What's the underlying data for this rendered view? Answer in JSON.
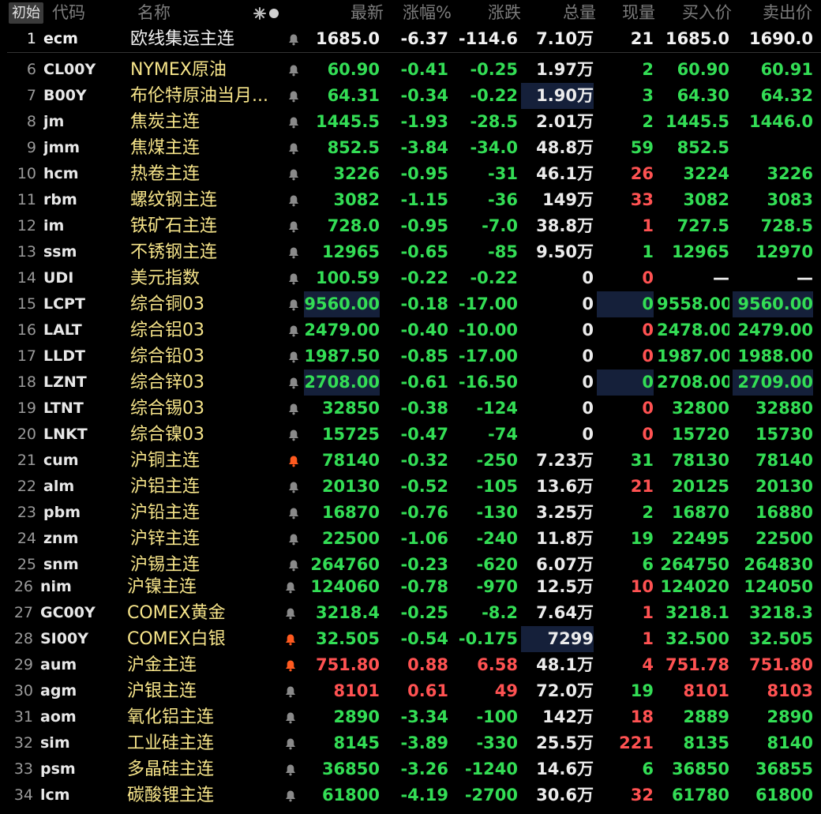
{
  "header": {
    "init_button": "初始",
    "columns": {
      "code": "代码",
      "name": "名称",
      "last": "最新",
      "pct": "涨幅%",
      "chg": "涨跌",
      "volume": "总量",
      "cur_vol": "现量",
      "bid": "买入价",
      "ask": "卖出价"
    },
    "sort_icon": "sort-mode-icon"
  },
  "colors": {
    "up": "#ff5252",
    "down": "#33dd55",
    "name": "#f7e58a",
    "highlight": "#15203a",
    "bell_active": "#ff5a1f"
  },
  "rows": [
    {
      "idx": "1",
      "code": "ecm",
      "name": "欧线集运主连",
      "bell": "normal",
      "last": "1685.0",
      "pct": "-6.37",
      "chg": "-114.6",
      "vol": "7.10万",
      "cur": "21",
      "bid": "1685.0",
      "ask": "1690.0",
      "dir": "dn",
      "curdir": "dn",
      "selected": true
    },
    {
      "idx": "6",
      "code": "CL00Y",
      "name": "NYMEX原油",
      "bell": "normal",
      "last": "60.90",
      "pct": "-0.41",
      "chg": "-0.25",
      "vol": "1.97万",
      "cur": "2",
      "bid": "60.90",
      "ask": "60.91",
      "dir": "dn",
      "curdir": "dn"
    },
    {
      "idx": "7",
      "code": "B00Y",
      "name": "布伦特原油当月...",
      "bell": "normal",
      "last": "64.31",
      "pct": "-0.34",
      "chg": "-0.22",
      "vol": "1.90万",
      "cur": "3",
      "bid": "64.30",
      "ask": "64.32",
      "dir": "dn",
      "curdir": "dn",
      "hl": [
        "vol"
      ]
    },
    {
      "idx": "8",
      "code": "jm",
      "name": "焦炭主连",
      "bell": "normal",
      "last": "1445.5",
      "pct": "-1.93",
      "chg": "-28.5",
      "vol": "2.01万",
      "cur": "2",
      "bid": "1445.5",
      "ask": "1446.0",
      "dir": "dn",
      "curdir": "dn"
    },
    {
      "idx": "9",
      "code": "jmm",
      "name": "焦煤主连",
      "bell": "normal",
      "last": "852.5",
      "pct": "-3.84",
      "chg": "-34.0",
      "vol": "48.8万",
      "cur": "59",
      "bid": "852.5",
      "ask": "",
      "dir": "dn",
      "curdir": "dn"
    },
    {
      "idx": "10",
      "code": "hcm",
      "name": "热卷主连",
      "bell": "normal",
      "last": "3226",
      "pct": "-0.95",
      "chg": "-31",
      "vol": "46.1万",
      "cur": "26",
      "bid": "3224",
      "ask": "3226",
      "dir": "dn",
      "curdir": "up"
    },
    {
      "idx": "11",
      "code": "rbm",
      "name": "螺纹钢主连",
      "bell": "normal",
      "last": "3082",
      "pct": "-1.15",
      "chg": "-36",
      "vol": "149万",
      "cur": "33",
      "bid": "3082",
      "ask": "3083",
      "dir": "dn",
      "curdir": "up"
    },
    {
      "idx": "12",
      "code": "im",
      "name": "铁矿石主连",
      "bell": "normal",
      "last": "728.0",
      "pct": "-0.95",
      "chg": "-7.0",
      "vol": "38.8万",
      "cur": "1",
      "bid": "727.5",
      "ask": "728.5",
      "dir": "dn",
      "curdir": "up"
    },
    {
      "idx": "13",
      "code": "ssm",
      "name": "不锈钢主连",
      "bell": "normal",
      "last": "12965",
      "pct": "-0.65",
      "chg": "-85",
      "vol": "9.50万",
      "cur": "1",
      "bid": "12965",
      "ask": "12970",
      "dir": "dn",
      "curdir": "dn"
    },
    {
      "idx": "14",
      "code": "UDI",
      "name": "美元指数",
      "bell": "normal",
      "last": "100.59",
      "pct": "-0.22",
      "chg": "-0.22",
      "vol": "0",
      "cur": "0",
      "bid": "—",
      "ask": "—",
      "dir": "dn",
      "curdir": "up",
      "bidask": "wt"
    },
    {
      "idx": "15",
      "code": "LCPT",
      "name": "综合铜03",
      "bell": "normal",
      "last": "9560.00",
      "pct": "-0.18",
      "chg": "-17.00",
      "vol": "0",
      "cur": "0",
      "bid": "9558.00",
      "ask": "9560.00",
      "dir": "dn",
      "curdir": "dn",
      "hl": [
        "last",
        "cur",
        "ask"
      ]
    },
    {
      "idx": "16",
      "code": "LALT",
      "name": "综合铝03",
      "bell": "normal",
      "last": "2479.00",
      "pct": "-0.40",
      "chg": "-10.00",
      "vol": "0",
      "cur": "0",
      "bid": "2478.00",
      "ask": "2479.00",
      "dir": "dn",
      "curdir": "up"
    },
    {
      "idx": "17",
      "code": "LLDT",
      "name": "综合铅03",
      "bell": "normal",
      "last": "1987.50",
      "pct": "-0.85",
      "chg": "-17.00",
      "vol": "0",
      "cur": "0",
      "bid": "1987.00",
      "ask": "1988.00",
      "dir": "dn",
      "curdir": "up"
    },
    {
      "idx": "18",
      "code": "LZNT",
      "name": "综合锌03",
      "bell": "normal",
      "last": "2708.00",
      "pct": "-0.61",
      "chg": "-16.50",
      "vol": "0",
      "cur": "0",
      "bid": "2708.00",
      "ask": "2709.00",
      "dir": "dn",
      "curdir": "dn",
      "hl": [
        "last",
        "cur",
        "ask"
      ]
    },
    {
      "idx": "19",
      "code": "LTNT",
      "name": "综合锡03",
      "bell": "normal",
      "last": "32850",
      "pct": "-0.38",
      "chg": "-124",
      "vol": "0",
      "cur": "0",
      "bid": "32800",
      "ask": "32880",
      "dir": "dn",
      "curdir": "up"
    },
    {
      "idx": "20",
      "code": "LNKT",
      "name": "综合镍03",
      "bell": "normal",
      "last": "15725",
      "pct": "-0.47",
      "chg": "-74",
      "vol": "0",
      "cur": "0",
      "bid": "15720",
      "ask": "15730",
      "dir": "dn",
      "curdir": "up"
    },
    {
      "idx": "21",
      "code": "cum",
      "name": "沪铜主连",
      "bell": "active",
      "last": "78140",
      "pct": "-0.32",
      "chg": "-250",
      "vol": "7.23万",
      "cur": "31",
      "bid": "78130",
      "ask": "78140",
      "dir": "dn",
      "curdir": "dn"
    },
    {
      "idx": "22",
      "code": "alm",
      "name": "沪铝主连",
      "bell": "normal",
      "last": "20130",
      "pct": "-0.52",
      "chg": "-105",
      "vol": "13.6万",
      "cur": "21",
      "bid": "20125",
      "ask": "20130",
      "dir": "dn",
      "curdir": "up"
    },
    {
      "idx": "23",
      "code": "pbm",
      "name": "沪铅主连",
      "bell": "normal",
      "last": "16870",
      "pct": "-0.76",
      "chg": "-130",
      "vol": "3.25万",
      "cur": "2",
      "bid": "16870",
      "ask": "16880",
      "dir": "dn",
      "curdir": "dn"
    },
    {
      "idx": "24",
      "code": "znm",
      "name": "沪锌主连",
      "bell": "normal",
      "last": "22500",
      "pct": "-1.06",
      "chg": "-240",
      "vol": "11.8万",
      "cur": "19",
      "bid": "22495",
      "ask": "22500",
      "dir": "dn",
      "curdir": "dn"
    },
    {
      "idx": "25",
      "code": "snm",
      "name": "沪锡主连",
      "bell": "normal",
      "last": "264760",
      "pct": "-0.23",
      "chg": "-620",
      "vol": "6.07万",
      "cur": "6",
      "bid": "264750",
      "ask": "264830",
      "dir": "dn",
      "curdir": "dn"
    },
    {
      "idx": "26",
      "code": "nim",
      "name": "沪镍主连",
      "bell": "normal",
      "last": "124060",
      "pct": "-0.78",
      "chg": "-970",
      "vol": "12.5万",
      "cur": "10",
      "bid": "124020",
      "ask": "124050",
      "dir": "dn",
      "curdir": "up"
    },
    {
      "idx": "27",
      "code": "GC00Y",
      "name": "COMEX黄金",
      "bell": "normal",
      "last": "3218.4",
      "pct": "-0.25",
      "chg": "-8.2",
      "vol": "7.64万",
      "cur": "1",
      "bid": "3218.1",
      "ask": "3218.3",
      "dir": "dn",
      "curdir": "up"
    },
    {
      "idx": "28",
      "code": "SI00Y",
      "name": "COMEX白银",
      "bell": "active",
      "last": "32.505",
      "pct": "-0.54",
      "chg": "-0.175",
      "vol": "7299",
      "cur": "1",
      "bid": "32.500",
      "ask": "32.505",
      "dir": "dn",
      "curdir": "up",
      "hl": [
        "vol"
      ]
    },
    {
      "idx": "29",
      "code": "aum",
      "name": "沪金主连",
      "bell": "active",
      "last": "751.80",
      "pct": "0.88",
      "chg": "6.58",
      "vol": "48.1万",
      "cur": "4",
      "bid": "751.78",
      "ask": "751.80",
      "dir": "up",
      "curdir": "up"
    },
    {
      "idx": "30",
      "code": "agm",
      "name": "沪银主连",
      "bell": "normal",
      "last": "8101",
      "pct": "0.61",
      "chg": "49",
      "vol": "72.0万",
      "cur": "19",
      "bid": "8101",
      "ask": "8103",
      "dir": "up",
      "curdir": "dn"
    },
    {
      "idx": "31",
      "code": "aom",
      "name": "氧化铝主连",
      "bell": "normal",
      "last": "2890",
      "pct": "-3.34",
      "chg": "-100",
      "vol": "142万",
      "cur": "18",
      "bid": "2889",
      "ask": "2890",
      "dir": "dn",
      "curdir": "up"
    },
    {
      "idx": "32",
      "code": "sim",
      "name": "工业硅主连",
      "bell": "normal",
      "last": "8145",
      "pct": "-3.89",
      "chg": "-330",
      "vol": "25.5万",
      "cur": "221",
      "bid": "8135",
      "ask": "8140",
      "dir": "dn",
      "curdir": "up"
    },
    {
      "idx": "33",
      "code": "psm",
      "name": "多晶硅主连",
      "bell": "normal",
      "last": "36850",
      "pct": "-3.26",
      "chg": "-1240",
      "vol": "14.6万",
      "cur": "6",
      "bid": "36850",
      "ask": "36855",
      "dir": "dn",
      "curdir": "dn"
    },
    {
      "idx": "34",
      "code": "lcm",
      "name": "碳酸锂主连",
      "bell": "normal",
      "last": "61800",
      "pct": "-4.19",
      "chg": "-2700",
      "vol": "30.6万",
      "cur": "32",
      "bid": "61780",
      "ask": "61800",
      "dir": "dn",
      "curdir": "up"
    }
  ]
}
